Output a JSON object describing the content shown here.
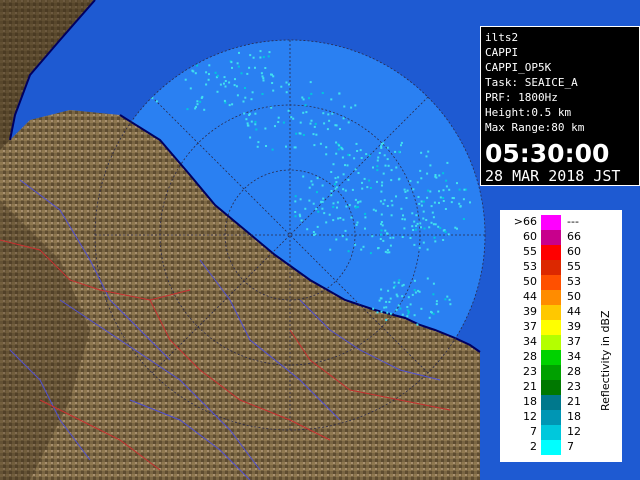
{
  "info": {
    "site": "ilts2",
    "product": "CAPPI",
    "product_code": "CAPPI_OP5K",
    "task": "Task: SEAICE_A",
    "prf": "PRF: 1800Hz",
    "height": "Height:0.5 km",
    "max_range": "Max Range:80 km",
    "time": "05:30:00",
    "date": "28 MAR 2018 JST"
  },
  "legend": {
    "title": "Reflectivity in dBZ",
    "rows": [
      {
        "low": ">66",
        "high": "---",
        "color": "#ff00ff"
      },
      {
        "low": "60",
        "high": "66",
        "color": "#c8008c"
      },
      {
        "low": "55",
        "high": "60",
        "color": "#ff0000"
      },
      {
        "low": "53",
        "high": "55",
        "color": "#dc2800"
      },
      {
        "low": "50",
        "high": "53",
        "color": "#ff5000"
      },
      {
        "low": "44",
        "high": "50",
        "color": "#ff8c00"
      },
      {
        "low": "39",
        "high": "44",
        "color": "#ffc800"
      },
      {
        "low": "37",
        "high": "39",
        "color": "#ffff00"
      },
      {
        "low": "34",
        "high": "37",
        "color": "#b4ff00"
      },
      {
        "low": "28",
        "high": "34",
        "color": "#00d200"
      },
      {
        "low": "23",
        "high": "28",
        "color": "#00a000"
      },
      {
        "low": "21",
        "high": "23",
        "color": "#007800"
      },
      {
        "low": "18",
        "high": "21",
        "color": "#00788c"
      },
      {
        "low": "12",
        "high": "18",
        "color": "#0096b4"
      },
      {
        "low": "7",
        "high": "12",
        "color": "#00c8dc"
      },
      {
        "low": "2",
        "high": "7",
        "color": "#00ffff"
      }
    ]
  },
  "colors": {
    "sea": "#1e5ad2",
    "radar_disc": "#2878f0",
    "land_dark": "#4a3a22",
    "land_light": "#a08a62",
    "echo": "#40e0f0",
    "coast": "#000060",
    "boundary_red": "#c83030",
    "rivers": "#5050d0"
  }
}
